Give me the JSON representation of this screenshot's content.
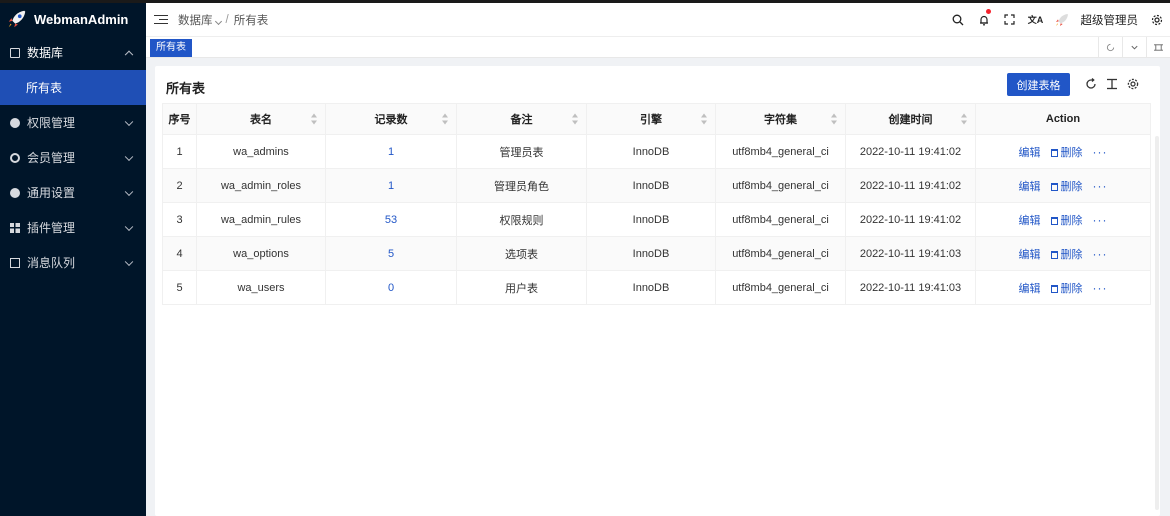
{
  "app": {
    "title": "WebmanAdmin"
  },
  "sidebar": {
    "items": [
      {
        "label": "数据库",
        "icon": "database-icon",
        "open": true,
        "children": [
          {
            "label": "所有表",
            "active": true
          }
        ]
      },
      {
        "label": "权限管理",
        "icon": "gear-icon"
      },
      {
        "label": "会员管理",
        "icon": "user-icon"
      },
      {
        "label": "通用设置",
        "icon": "gear-icon"
      },
      {
        "label": "插件管理",
        "icon": "grid-icon"
      },
      {
        "label": "消息队列",
        "icon": "document-icon"
      }
    ]
  },
  "header": {
    "breadcrumb": [
      "数据库",
      "所有表"
    ],
    "separator": "/",
    "username": "超级管理员",
    "translate_glyph": "文A"
  },
  "tabs": {
    "active": "所有表"
  },
  "card": {
    "title": "所有表",
    "create_label": "创建表格"
  },
  "table": {
    "columns": [
      "序号",
      "表名",
      "记录数",
      "备注",
      "引擎",
      "字符集",
      "创建时间",
      "Action"
    ],
    "rows": [
      {
        "index": "1",
        "name": "wa_admins",
        "count": "1",
        "comment": "管理员表",
        "engine": "InnoDB",
        "charset": "utf8mb4_general_ci",
        "created": "2022-10-11 19:41:02"
      },
      {
        "index": "2",
        "name": "wa_admin_roles",
        "count": "1",
        "comment": "管理员角色",
        "engine": "InnoDB",
        "charset": "utf8mb4_general_ci",
        "created": "2022-10-11 19:41:02"
      },
      {
        "index": "3",
        "name": "wa_admin_rules",
        "count": "53",
        "comment": "权限规则",
        "engine": "InnoDB",
        "charset": "utf8mb4_general_ci",
        "created": "2022-10-11 19:41:02"
      },
      {
        "index": "4",
        "name": "wa_options",
        "count": "5",
        "comment": "选项表",
        "engine": "InnoDB",
        "charset": "utf8mb4_general_ci",
        "created": "2022-10-11 19:41:03"
      },
      {
        "index": "5",
        "name": "wa_users",
        "count": "0",
        "comment": "用户表",
        "engine": "InnoDB",
        "charset": "utf8mb4_general_ci",
        "created": "2022-10-11 19:41:03"
      }
    ],
    "edit_label": "编辑",
    "delete_label": "删除",
    "more_label": "···"
  },
  "colors": {
    "sidebar_bg": "#001529",
    "accent": "#2156c7",
    "notify_dot": "#f5222d"
  }
}
